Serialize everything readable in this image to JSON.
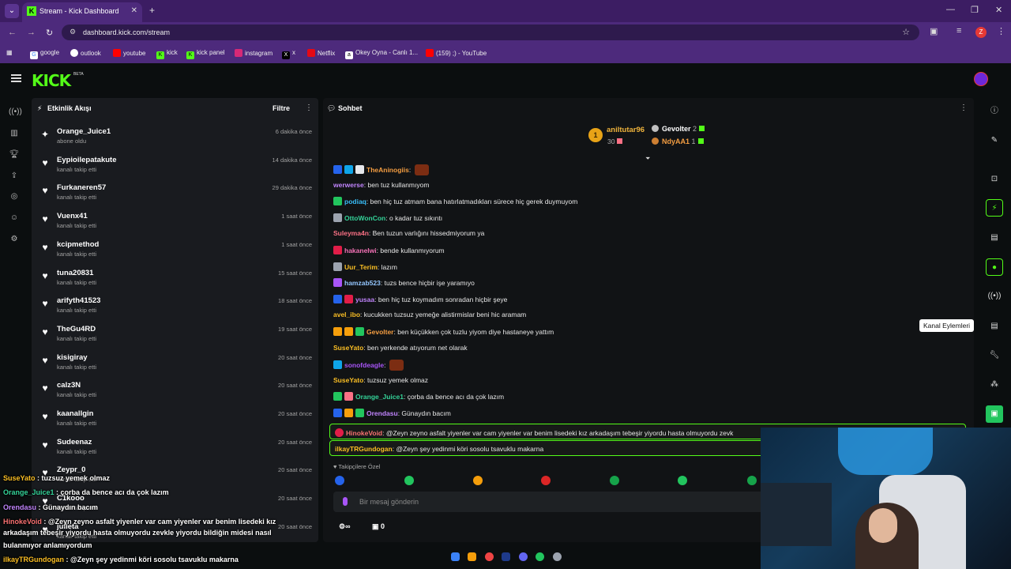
{
  "browser": {
    "tab_title": "Stream - Kick Dashboard",
    "url": "dashboard.kick.com/stream",
    "profile_letter": "Z",
    "bookmarks": [
      "google",
      "outlook",
      "youtube",
      "kick",
      "kick panel",
      "instagram",
      "x",
      "Netflix",
      "Okey Oyna - Canlı 1...",
      "(159) ;) - YouTube"
    ]
  },
  "header": {
    "logo": "KICK",
    "beta": "BETA"
  },
  "activity": {
    "title": "Etkinlik Akışı",
    "filter": "Filtre",
    "items": [
      {
        "name": "Orange_Juice1",
        "action": "abone oldu",
        "time": "6 dakika önce",
        "icon": "sparkle-icon"
      },
      {
        "name": "Eypioilepatakute",
        "action": "kanalı takip etti",
        "time": "14 dakika önce",
        "icon": "heart-icon"
      },
      {
        "name": "Furkaneren57",
        "action": "kanalı takip etti",
        "time": "29 dakika önce",
        "icon": "heart-icon"
      },
      {
        "name": "Vuenx41",
        "action": "kanalı takip etti",
        "time": "1 saat önce",
        "icon": "heart-icon"
      },
      {
        "name": "kcipmethod",
        "action": "kanalı takip etti",
        "time": "1 saat önce",
        "icon": "heart-icon"
      },
      {
        "name": "tuna20831",
        "action": "kanalı takip etti",
        "time": "15 saat önce",
        "icon": "heart-icon"
      },
      {
        "name": "arifyth41523",
        "action": "kanalı takip etti",
        "time": "18 saat önce",
        "icon": "heart-icon"
      },
      {
        "name": "TheGu4RD",
        "action": "kanalı takip etti",
        "time": "19 saat önce",
        "icon": "heart-icon"
      },
      {
        "name": "kisigiray",
        "action": "kanalı takip etti",
        "time": "20 saat önce",
        "icon": "heart-icon"
      },
      {
        "name": "calz3N",
        "action": "kanalı takip etti",
        "time": "20 saat önce",
        "icon": "heart-icon"
      },
      {
        "name": "kaanallgin",
        "action": "kanalı takip etti",
        "time": "20 saat önce",
        "icon": "heart-icon"
      },
      {
        "name": "Sudeenaz",
        "action": "kanalı takip etti",
        "time": "20 saat önce",
        "icon": "heart-icon"
      },
      {
        "name": "Zeypr_0",
        "action": "kanalı takip etti",
        "time": "20 saat önce",
        "icon": "heart-icon"
      },
      {
        "name": "C1kooo",
        "action": "kanalı takip etti",
        "time": "20 saat önce",
        "icon": "heart-icon"
      },
      {
        "name": "julleta",
        "action": "kanalı takip etti",
        "time": "20 saat önce",
        "icon": "heart-icon"
      }
    ]
  },
  "chat": {
    "title": "Sohbet",
    "leaderboard": {
      "first": {
        "name": "aniltutar96",
        "count": "30",
        "rank": "1"
      },
      "second": {
        "name": "Gevolter",
        "count": "2"
      },
      "third": {
        "name": "NdyAA1",
        "count": "1"
      }
    },
    "messages": [
      {
        "user": "TheAninogiis",
        "color": "#f59e42",
        "text": ""
      },
      {
        "user": "werwerse",
        "color": "#c084fc",
        "text": "ben tuz kullanmıyom"
      },
      {
        "user": "podiaq",
        "color": "#38bdf8",
        "text": "ben hiç tuz atmam bana hatırlatmadıkları sürece hiç gerek duymuyom"
      },
      {
        "user": "OttoWonCon",
        "color": "#34d399",
        "text": "o kadar tuz sıkıntı"
      },
      {
        "user": "Suleyma4n",
        "color": "#fb7185",
        "text": "Ben tuzun varlığını hissedmiyorum ya"
      },
      {
        "user": "hakanelwi",
        "color": "#f472b6",
        "text": "bende kullanmıyorum"
      },
      {
        "user": "Uur_Terim",
        "color": "#fbbf24",
        "text": "lazım"
      },
      {
        "user": "hamzab523",
        "color": "#93c5fd",
        "text": "tuzs bence hiçbir işe yaramıyo"
      },
      {
        "user": "yusaa",
        "color": "#c084fc",
        "text": "ben hiç tuz koymadım sonradan hiçbir şeye"
      },
      {
        "user": "avel_ibo",
        "color": "#fbbf24",
        "text": "kucukken tuzsuz yemeğe alistirmislar beni hic aramam"
      },
      {
        "user": "Gevolter",
        "color": "#f59e42",
        "text": "ben küçükken çok tuzlu yiyom diye hastaneye yattım"
      },
      {
        "user": "SuseYato",
        "color": "#fbbf24",
        "text": "ben yerkende atıyorum net olarak"
      },
      {
        "user": "sonofdeagle",
        "color": "#a855f7",
        "text": ""
      },
      {
        "user": "SuseYato",
        "color": "#fbbf24",
        "text": "tuzsuz yemek olmaz"
      },
      {
        "user": "Orange_Juice1",
        "color": "#34d399",
        "text": "çorba da bence acı da çok lazım"
      },
      {
        "user": "Orendasu",
        "color": "#c084fc",
        "text": "Günaydın bacım"
      }
    ],
    "highlighted": [
      {
        "user": "HinokeVoid",
        "color": "#f87171",
        "text": "@Zeyn zeyno asfalt yiyenler var cam yiyenler var benim lisedeki kız arkadaşım tebeşir yiyordu hasta olmuyordu zevk"
      },
      {
        "user": "ilkayTRGundogan",
        "color": "#fbbf24",
        "text": "@Zeyn şey yedinmi köri sosolu tsavuklu makarna"
      }
    ],
    "emote_label": "Takipçilere Özel",
    "input_placeholder": "Bir mesaj gönderin",
    "footer_count": "0"
  },
  "right_rail": {
    "tooltip": "Kanal Eylemleri"
  },
  "overlay_chat": [
    {
      "user": "SuseYato",
      "color": "#fbbf24",
      "text": "tuzsuz yemek olmaz"
    },
    {
      "user": "Orange_Juice1",
      "color": "#34d399",
      "text": "çorba da bence acı da çok lazım"
    },
    {
      "user": "Orendasu",
      "color": "#c084fc",
      "text": "Günaydın bacım"
    },
    {
      "user": "HinokeVoid",
      "color": "#f87171",
      "text": "@Zeyn zeyno asfalt yiyenler var cam yiyenler var benim lisedeki kız"
    },
    {
      "user": "",
      "color": "#ffffff",
      "text": "arkadaşım tebeşir yiyordu hasta olmuyordu zevkle yiyordu bildiğin midesi nasıl"
    },
    {
      "user": "",
      "color": "#ffffff",
      "text": "bulanmıyor anlamıyordum"
    },
    {
      "user": "ilkayTRGundogan",
      "color": "#fbbf24",
      "text": "@Zeyn şey yedinmi köri sosolu tsavuklu makarna"
    }
  ],
  "colors": {
    "accent": "#53fc18",
    "bg": "#0b0e0f",
    "panel": "#191b1f",
    "chrome": "#4d2a7c"
  }
}
